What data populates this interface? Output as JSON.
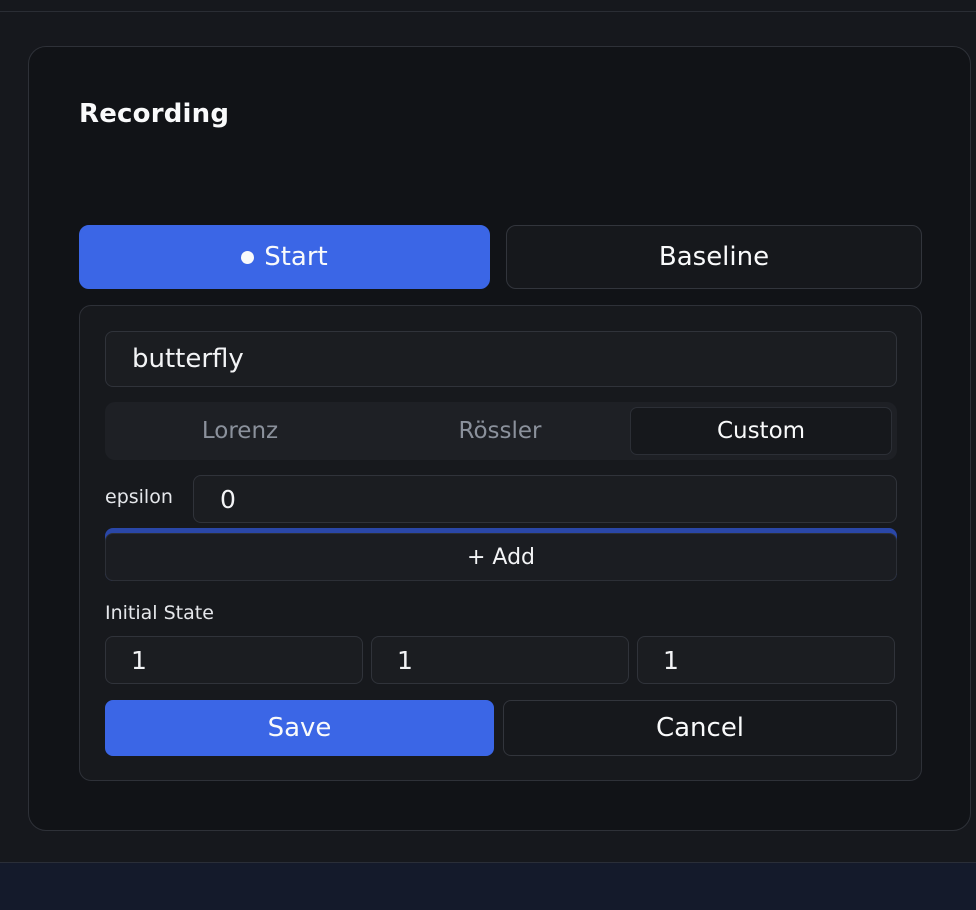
{
  "panel": {
    "title": "Recording"
  },
  "recording": {
    "start_label": "Start",
    "baseline_label": "Baseline"
  },
  "form": {
    "name_value": "butterfly",
    "tabs": [
      {
        "label": "Lorenz",
        "active": false
      },
      {
        "label": "Rössler",
        "active": false
      },
      {
        "label": "Custom",
        "active": true
      }
    ],
    "param": {
      "label": "epsilon",
      "value": "0"
    },
    "add_label": "+ Add",
    "initial_state_label": "Initial State",
    "initial_state": [
      "1",
      "1",
      "1"
    ],
    "save_label": "Save",
    "cancel_label": "Cancel"
  },
  "colors": {
    "accent": "#3b66e6",
    "background": "#111317",
    "surface": "#17191d"
  }
}
